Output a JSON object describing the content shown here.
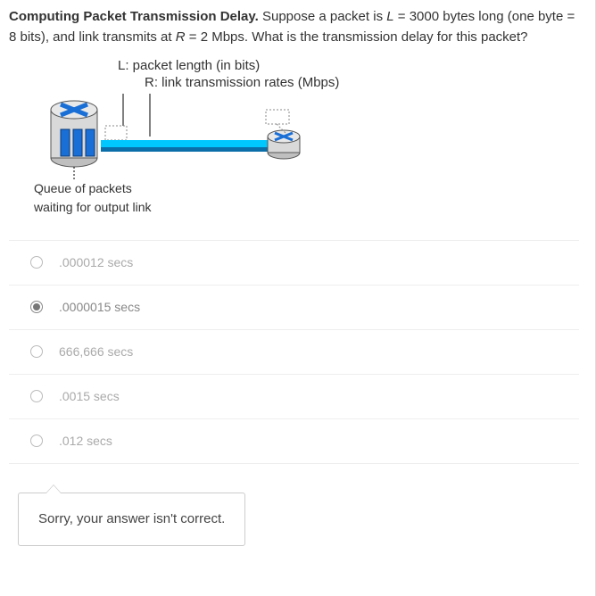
{
  "question": {
    "title": "Computing Packet Transmission Delay.",
    "body1": " Suppose a packet is ",
    "var1": "L",
    "eq1": " = 3000 bytes long (one byte = 8 bits), and link transmits at ",
    "var2": "R",
    "eq2": " = 2 Mbps.   What is the transmission delay for this packet?"
  },
  "diagram": {
    "label_L_prefix": "L:",
    "label_L": " packet length (in bits)",
    "label_R_prefix": "R:",
    "label_R": " link transmission rates (Mbps)",
    "queue_caption_line1": "Queue of packets",
    "queue_caption_line2": "waiting for output link"
  },
  "options": [
    {
      "label": ".000012 secs",
      "selected": false
    },
    {
      "label": ".0000015 secs",
      "selected": true
    },
    {
      "label": "666,666 secs",
      "selected": false
    },
    {
      "label": ".0015 secs",
      "selected": false
    },
    {
      "label": ".012 secs",
      "selected": false
    }
  ],
  "feedback": "Sorry, your answer isn't correct."
}
